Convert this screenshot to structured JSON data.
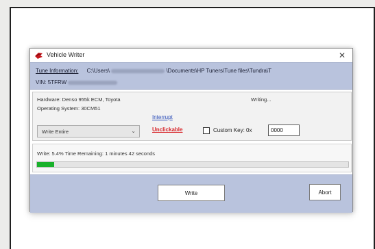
{
  "dialog": {
    "title": "Vehicle Writer",
    "close_glyph": "✕"
  },
  "info": {
    "tune_label": "Tune Information:",
    "tune_path_prefix": "C:\\Users\\",
    "tune_path_suffix": "\\Documents\\HP Tuners\\Tune files\\Tundra\\T",
    "vin_label": "VIN: 5TFRW"
  },
  "hardware": {
    "hardware_line": "Hardware: Denso 955k ECM,  Toyota",
    "os_line": "Operating System: 30CM51",
    "status": "Writing..."
  },
  "controls": {
    "mode_selected": "Write Entire",
    "link_blue": "Interrupt",
    "link_red": "Unclickable",
    "custom_key_label": "Custom Key: 0x",
    "custom_key_value": "0000",
    "custom_key_checked": false
  },
  "progress": {
    "text": "Write: 5.4% Time Remaining: 1 minutes 42 seconds",
    "percent": 5.4,
    "fill_color": "#19b12b"
  },
  "buttons": {
    "write": "Write",
    "abort": "Abort"
  },
  "colors": {
    "band": "#b9c3dd",
    "link_blue": "#2a4cb8",
    "link_red": "#d8262b"
  },
  "icons": {
    "title_icon": "hp-tuners-logo-icon",
    "dropdown": "chevron-down-icon"
  }
}
